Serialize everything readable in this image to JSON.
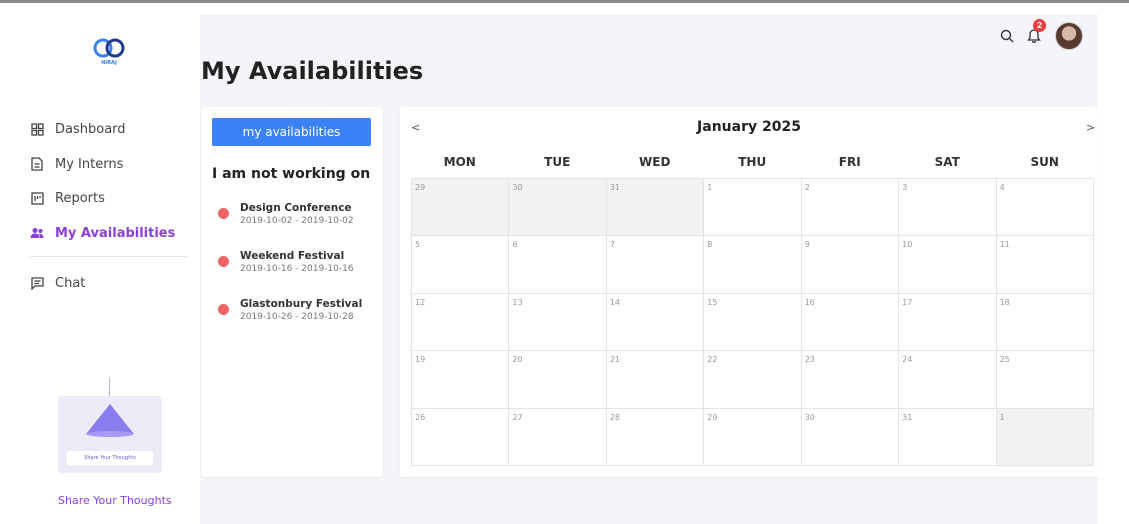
{
  "brand": {
    "logo_text": "NIRAJ"
  },
  "sidebar": {
    "items": [
      {
        "label": "Dashboard",
        "icon": "grid-icon"
      },
      {
        "label": "My Interns",
        "icon": "document-icon"
      },
      {
        "label": "Reports",
        "icon": "report-icon"
      },
      {
        "label": "My Availabilities",
        "icon": "users-icon",
        "active": true
      }
    ],
    "chat": {
      "label": "Chat",
      "icon": "chat-icon"
    },
    "promo": {
      "button_label": "Share Your Thoughts",
      "link_label": "Share Your Thoughts"
    }
  },
  "header": {
    "title": "My Availabilities",
    "notification_count": "2"
  },
  "left_panel": {
    "button_label": "my availabilities",
    "heading": "I am not working on",
    "events": [
      {
        "name": "Design Conference",
        "dates": "2019-10-02 - 2019-10-02"
      },
      {
        "name": "Weekend Festival",
        "dates": "2019-10-16 - 2019-10-16"
      },
      {
        "name": "Glastonbury Festival",
        "dates": "2019-10-26 - 2019-10-28"
      }
    ]
  },
  "calendar": {
    "prev": "<",
    "next": ">",
    "title": "January 2025",
    "weekdays": [
      "MON",
      "TUE",
      "WED",
      "THU",
      "FRI",
      "SAT",
      "SUN"
    ],
    "weeks": [
      [
        "29",
        "30",
        "31",
        "1",
        "2",
        "3",
        "4"
      ],
      [
        "5",
        "6",
        "7",
        "8",
        "9",
        "10",
        "11"
      ],
      [
        "12",
        "13",
        "14",
        "15",
        "16",
        "17",
        "18"
      ],
      [
        "19",
        "20",
        "21",
        "22",
        "23",
        "24",
        "25"
      ],
      [
        "26",
        "27",
        "28",
        "29",
        "30",
        "31",
        "1"
      ]
    ],
    "outside_month": [
      [
        0,
        0
      ],
      [
        0,
        1
      ],
      [
        0,
        2
      ],
      [
        4,
        6
      ]
    ]
  },
  "colors": {
    "accent": "#8b3fd9",
    "primary": "#3b82f6",
    "event_dot": "#f06565",
    "badge": "#ee3b3b"
  }
}
